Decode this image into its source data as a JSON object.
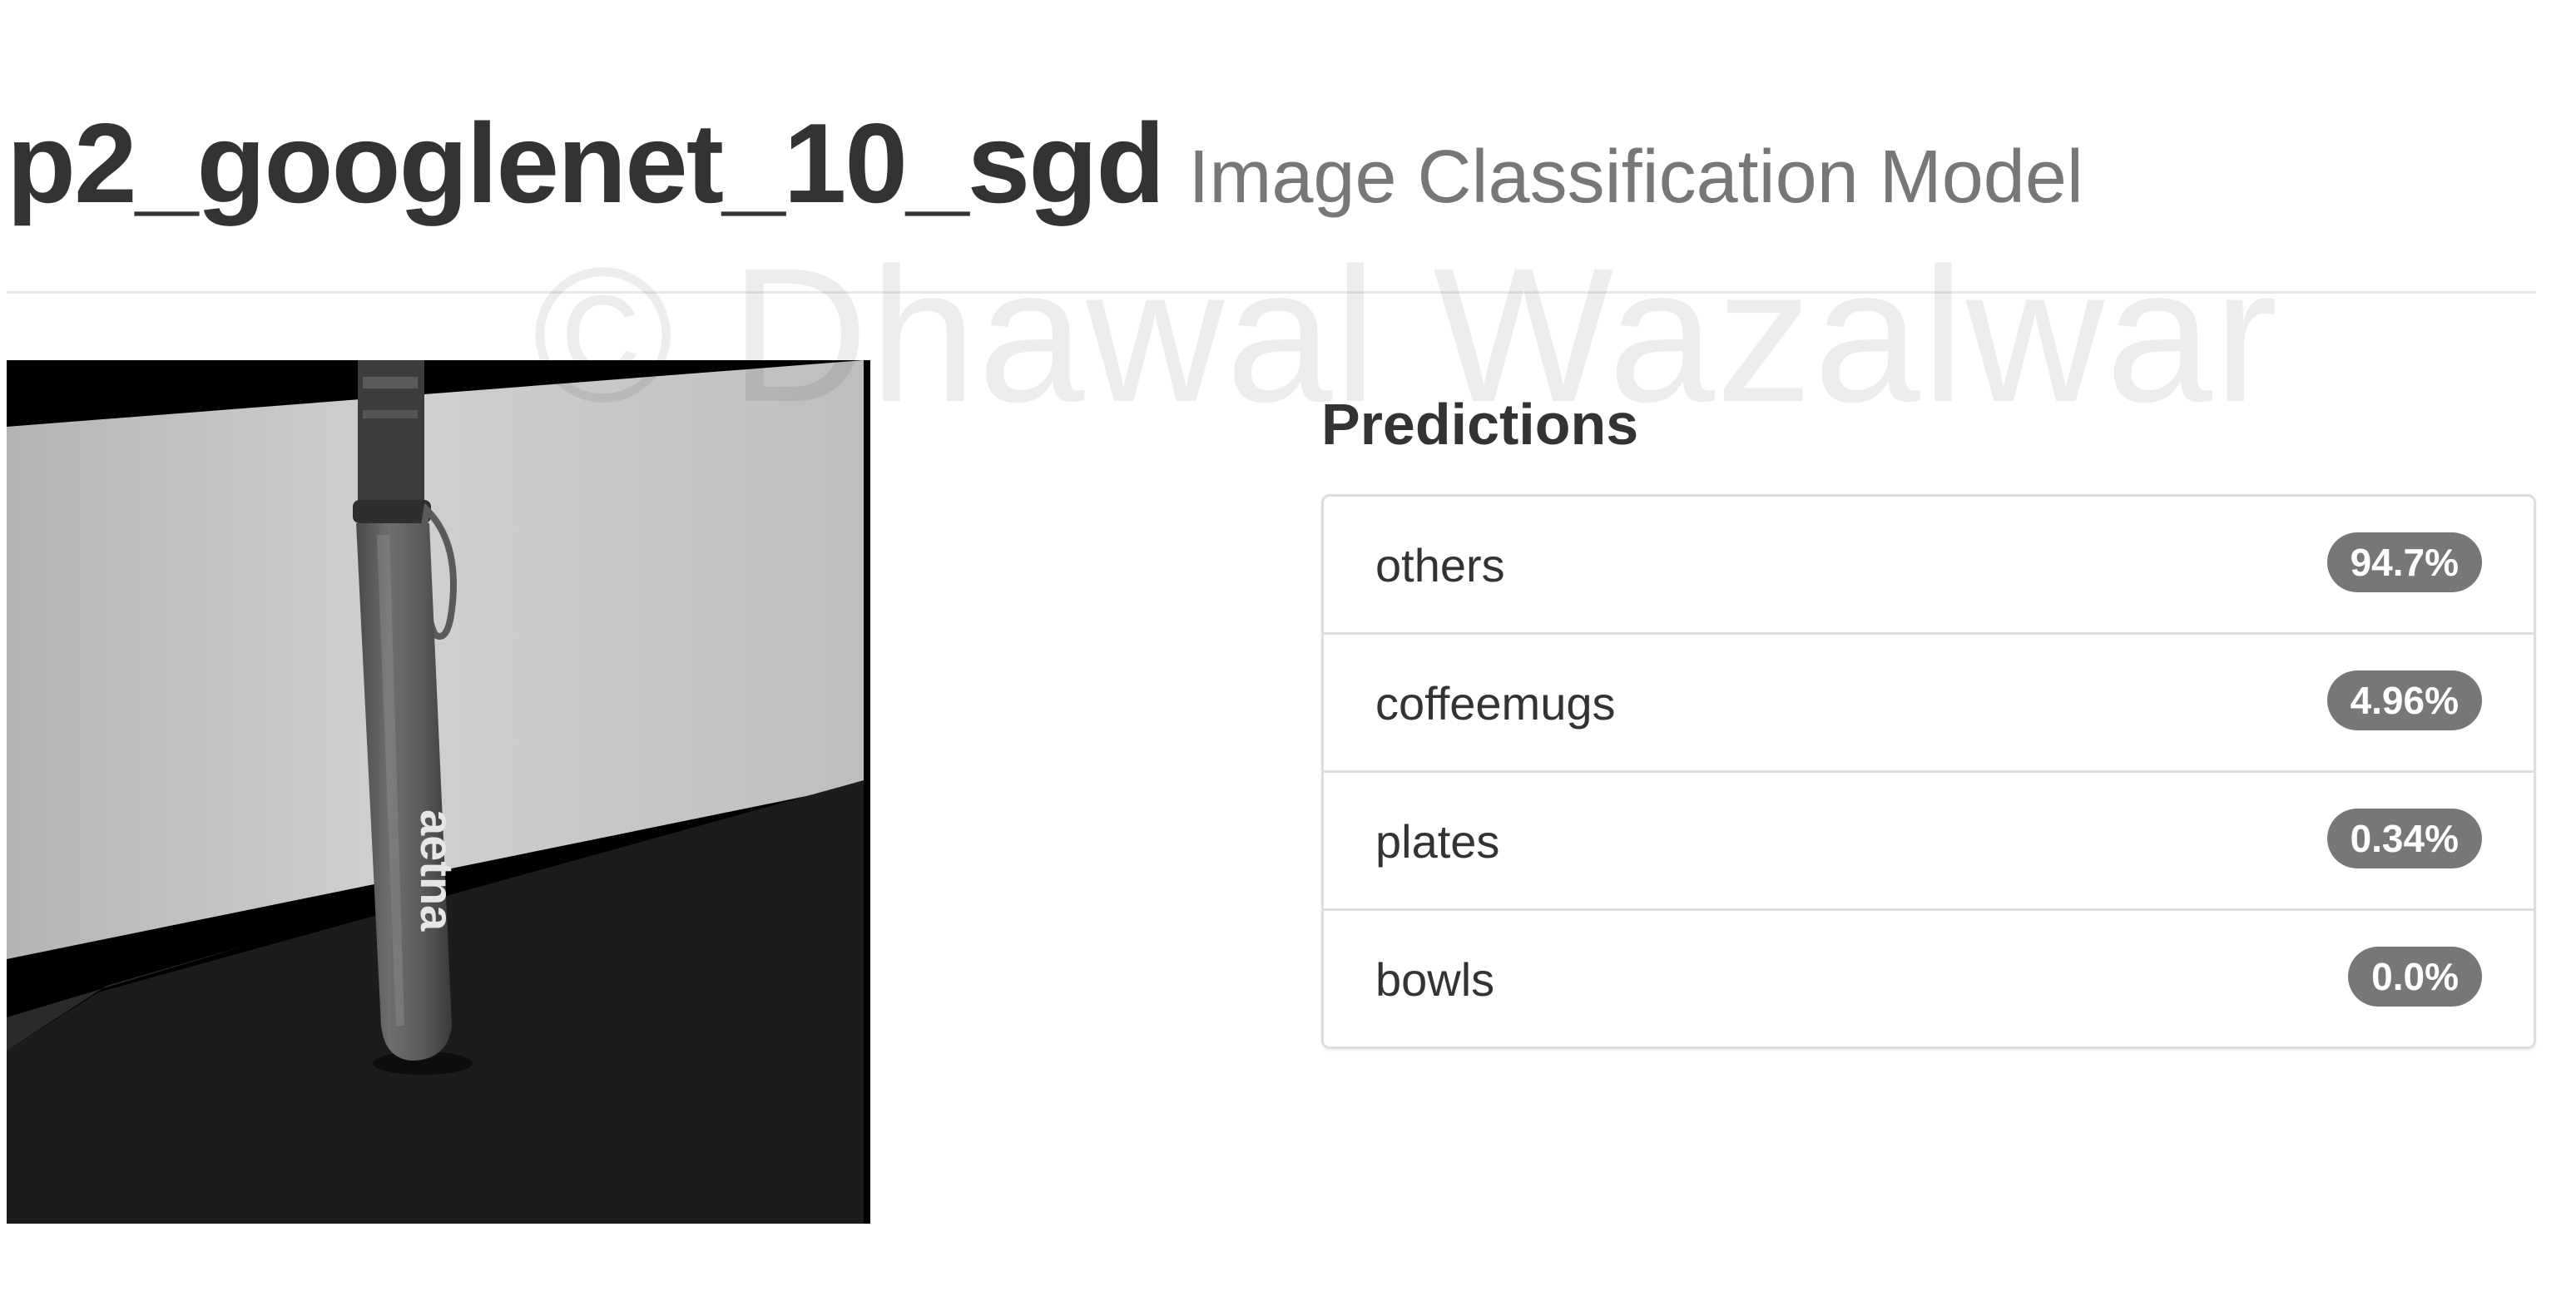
{
  "header": {
    "model_name": "p2_googlenet_10_sgd",
    "subtitle": "Image Classification Model"
  },
  "watermark": "© Dhawal Wazalwar",
  "photo": {
    "bottle_text": "aetna"
  },
  "predictions": {
    "heading": "Predictions",
    "items": [
      {
        "label": "others",
        "value": "94.7%"
      },
      {
        "label": "coffeemugs",
        "value": "4.96%"
      },
      {
        "label": "plates",
        "value": "0.34%"
      },
      {
        "label": "bowls",
        "value": "0.0%"
      }
    ]
  },
  "colors": {
    "badge": "#777777",
    "heading": "#333333",
    "subtitle": "#777777",
    "border": "#dddddd"
  }
}
